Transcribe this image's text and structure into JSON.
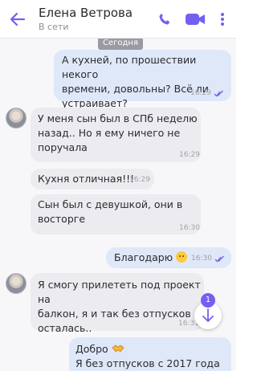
{
  "header": {
    "title": "Елена Ветрова",
    "status": "В сети",
    "accent": "#7360f2"
  },
  "date_divider": "Сегодня",
  "messages": [
    {
      "direction": "out",
      "lines": [
        "А кухней, по прошествии некого",
        "времени, довольны? Всё ли",
        "устраивает?"
      ],
      "time": "16:29",
      "read": true
    },
    {
      "direction": "in",
      "avatar": true,
      "lines": [
        "У меня сын был в СПб неделю",
        "назад.. Но я ему ничего не",
        "поручала"
      ],
      "time": "16:29"
    },
    {
      "direction": "in",
      "lines": [
        "Кухня отличная!!!"
      ],
      "time": "16:29"
    },
    {
      "direction": "in",
      "lines": [
        "Сын был с девушкой, они в",
        "восторге"
      ],
      "time": "16:30"
    },
    {
      "direction": "out",
      "lines": [
        "Благодарю"
      ],
      "emoji": "blush-face",
      "time": "16:30",
      "read": true
    },
    {
      "direction": "in",
      "avatar": true,
      "lines": [
        "Я смогу прилететь под проект на",
        "балкон, я и так без отпусков",
        "осталась.."
      ],
      "time": "16:31"
    },
    {
      "direction": "out",
      "lines": [
        "Добро",
        "Я без отпусков с 2017 года"
      ],
      "emoji": "handshake",
      "time": ""
    }
  ],
  "scroll_button": {
    "unread_count": "1",
    "icon": "arrow-down-icon"
  }
}
